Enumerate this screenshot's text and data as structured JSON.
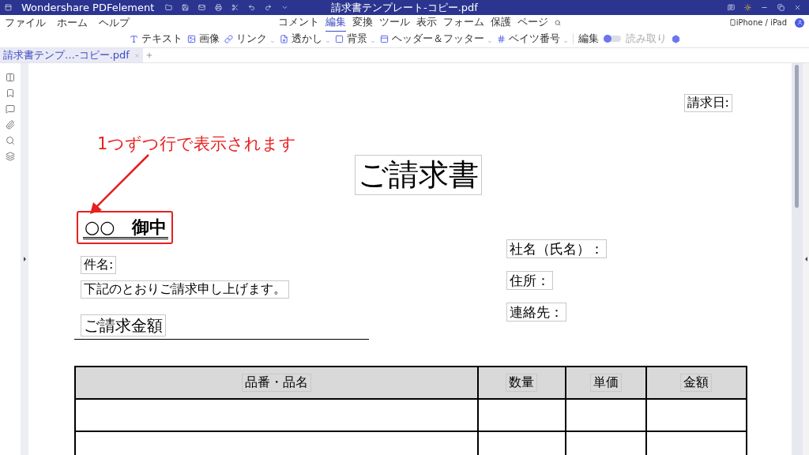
{
  "app": {
    "name": "Wondershare PDFelement",
    "file_title": "請求書テンプレート-コピー.pdf"
  },
  "menu": [
    "ファイル",
    "ホーム",
    "ヘルプ"
  ],
  "ribbon_tabs": [
    {
      "label": "コメント",
      "selected": false
    },
    {
      "label": "編集",
      "selected": true
    },
    {
      "label": "変換",
      "selected": false
    },
    {
      "label": "ツール",
      "selected": false
    },
    {
      "label": "表示",
      "selected": false
    },
    {
      "label": "フォーム",
      "selected": false
    },
    {
      "label": "保護",
      "selected": false
    },
    {
      "label": "ページ",
      "selected": false
    }
  ],
  "device_link": "iPhone / iPad",
  "toolbar": [
    {
      "kind": "text",
      "label": "テキスト",
      "dropdown": false
    },
    {
      "kind": "image",
      "label": "画像",
      "dropdown": false
    },
    {
      "kind": "link",
      "label": "リンク",
      "dropdown": true
    },
    {
      "kind": "watermark",
      "label": "透かし",
      "dropdown": true
    },
    {
      "kind": "background",
      "label": "背景",
      "dropdown": true
    },
    {
      "kind": "header",
      "label": "ヘッダー＆フッター",
      "dropdown": true
    },
    {
      "kind": "bates",
      "label": "ベイツ番号",
      "dropdown": true
    }
  ],
  "mode_switch": {
    "edit_label": "編集",
    "read_label": "読み取り",
    "reading": false
  },
  "doc_tabs": [
    {
      "label": "請求書テンプ…-コピー.pdf",
      "selected": true
    }
  ],
  "document": {
    "date_label": "請求日:",
    "title": "ご請求書",
    "recipient": "○○　御中",
    "subject_label": "件名:",
    "message": "下記のとおりご請求申し上げます。",
    "amount_label": "ご請求金額",
    "company_label": "社名（氏名）：",
    "address_label": "住所：",
    "contact_label": "連絡先：",
    "table_columns": [
      "品番・品名",
      "数量",
      "単価",
      "金額"
    ]
  },
  "annotation": {
    "text": "1つずつ行で表示されます"
  }
}
